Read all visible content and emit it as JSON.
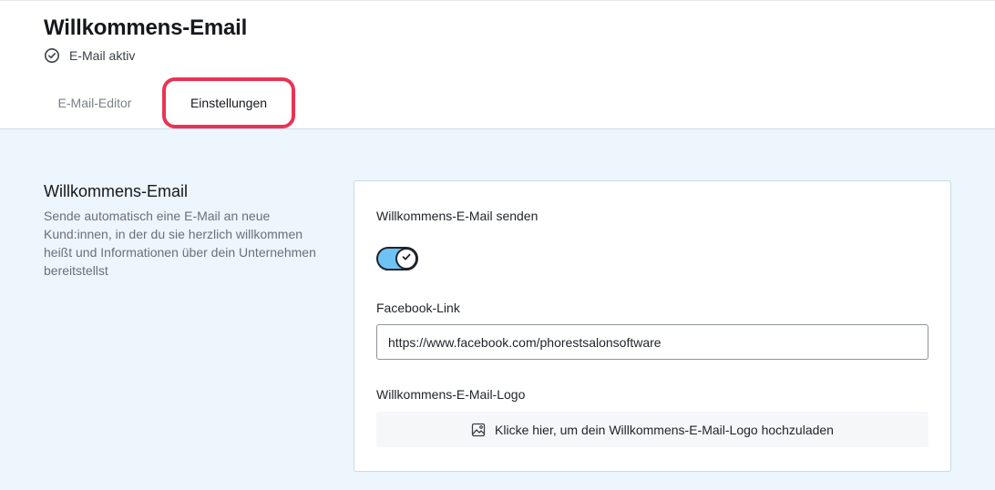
{
  "header": {
    "title": "Willkommens-Email",
    "status_icon": "check-circle-icon",
    "status_text": "E-Mail aktiv",
    "tabs": [
      {
        "label": "E-Mail-Editor",
        "active": false
      },
      {
        "label": "Einstellungen",
        "active": true
      }
    ],
    "highlight_color": "#ea3352"
  },
  "section": {
    "title": "Willkommens-Email",
    "description": "Sende automatisch eine E-Mail an neue Kund:innen, in der du sie herzlich willkommen heißt und Informationen über dein Unternehmen bereitstellst"
  },
  "settings": {
    "send_label": "Willkommens-E-Mail senden",
    "send_enabled": true,
    "toggle_color": "#6ec3f4",
    "facebook_label": "Facebook-Link",
    "facebook_value": "https://www.facebook.com/phorestsalonsoftware",
    "logo_label": "Willkommens-E-Mail-Logo",
    "upload_icon": "image-icon",
    "upload_text": "Klicke hier, um dein Willkommens-E-Mail-Logo hochzuladen"
  }
}
